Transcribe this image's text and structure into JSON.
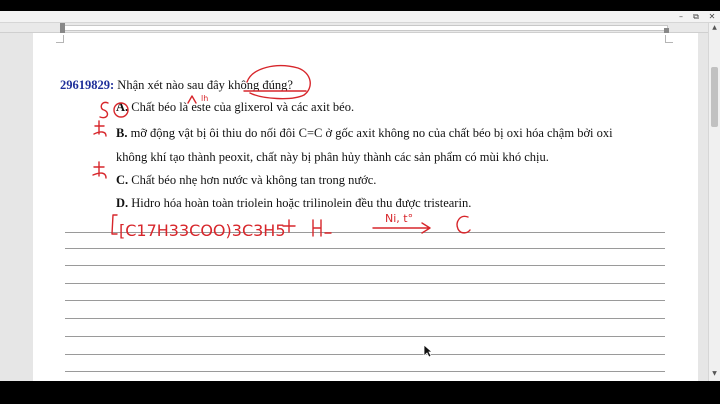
{
  "window": {
    "controls": {
      "minimize": "–",
      "restore": "⧉",
      "close": "✕"
    }
  },
  "question": {
    "id": "29619829:",
    "prompt_before": "Nhận xét nào sau đây ",
    "prompt_emphasis": "không đúng",
    "prompt_after": "?"
  },
  "options": [
    {
      "letter": "A.",
      "text": " Chất béo là este của glixerol và các axit béo."
    },
    {
      "letter": "B.",
      "text": " mỡ động vật bị ôi thiu do nối đôi C=C ở gốc axit không no của chất béo bị oxi hóa chậm bởi oxi"
    },
    {
      "letter": "",
      "text": "không khí tạo thành peoxit, chất này bị phân hủy thành các sản phẩm có mùi khó chịu."
    },
    {
      "letter": "C.",
      "text": " Chất béo nhẹ hơn nước và không tan trong nước."
    },
    {
      "letter": "D.",
      "text": " Hidro hóa hoàn toàn triolein hoặc trilinolein đều thu được tristearin."
    }
  ],
  "annotations": {
    "mark_a": "S",
    "small_note": "lh",
    "equation_left": "[C17H33COO)3C3H5",
    "plus": "+",
    "h2": "H2",
    "catalyst": "Ni, t°",
    "product_start": "C"
  },
  "colors": {
    "question_id": "#1f2f9a",
    "ink_red": "#d7262b",
    "page": "#ffffff",
    "workspace": "#e6e6e6"
  },
  "icons": [
    "minimize-icon",
    "restore-icon",
    "close-icon",
    "scroll-up-icon",
    "scroll-down-icon",
    "mouse-cursor-icon"
  ]
}
